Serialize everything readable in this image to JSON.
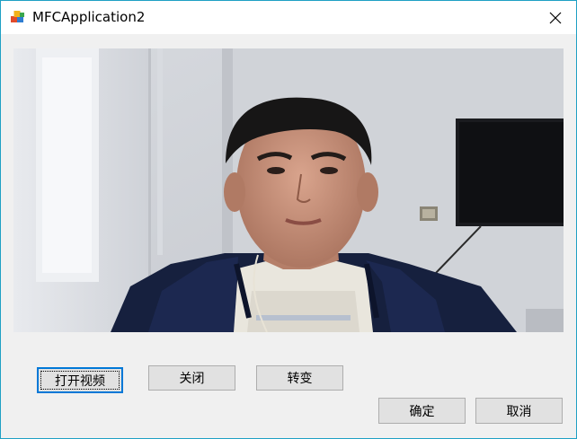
{
  "window": {
    "title": "MFCApplication2",
    "title_icon": "mfc-app-icon",
    "close_icon": "close-icon",
    "border_color": "#1fa0c4"
  },
  "video": {
    "content": "webcam-preview-image"
  },
  "buttons": {
    "open_video": "打开视频",
    "close": "关闭",
    "transform": "转变",
    "ok": "确定",
    "cancel": "取消"
  },
  "colors": {
    "button_face": "#e1e1e1",
    "button_border": "#adadad",
    "focus_border": "#0078d7",
    "dialog_bg": "#f0f0f0"
  }
}
